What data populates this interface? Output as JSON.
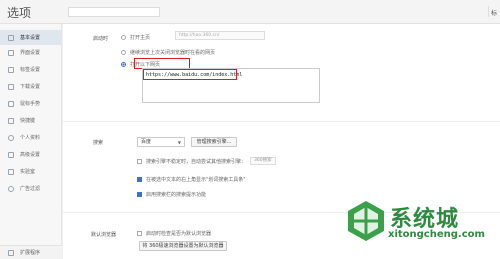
{
  "header": {
    "title": "选项",
    "right_label": "标"
  },
  "sidebar": {
    "items": [
      {
        "label": "基本设置",
        "icon": "gear-icon",
        "active": true
      },
      {
        "label": "界面设置",
        "icon": "window-icon"
      },
      {
        "label": "标签设置",
        "icon": "tab-icon"
      },
      {
        "label": "下载设置",
        "icon": "download-icon"
      },
      {
        "label": "鼠标手势",
        "icon": "mouse-icon"
      },
      {
        "label": "快捷键",
        "icon": "keyboard-icon"
      },
      {
        "label": "个人资料",
        "icon": "user-icon"
      },
      {
        "label": "高级设置",
        "icon": "advanced-icon"
      },
      {
        "label": "实验室",
        "icon": "lab-icon"
      },
      {
        "label": "广告过滤",
        "icon": "filter-icon"
      }
    ],
    "bottom": {
      "label": "扩展程序",
      "icon": "extension-icon"
    }
  },
  "startup": {
    "section_label": "启动时",
    "opt_homepage": "打开主页",
    "homepage_value": "http://hao.360.cn/",
    "opt_restore": "继续浏览上次关闭浏览器时在看的网页",
    "opt_open_pages": "打开以下网页",
    "urls": "https://www.baidu.com/index.html"
  },
  "search": {
    "section_label": "搜索",
    "engine": "百度",
    "manage_button": "管理搜索引擎...",
    "opt_suggest": "搜索引擎不稳定时，自动尝试其他搜索引擎：",
    "suggest_select": "360搜索",
    "opt_selected_text": "在被选中文本的右上角显示\"划词搜索工具条\"",
    "opt_enable_suggest": "启用搜索栏的搜索提示功能"
  },
  "default_browser": {
    "section_label": "默认浏览器",
    "opt_check": "启动时检查是否为默认浏览器",
    "set_button": "将 360极速浏览器设置为默认浏览器"
  },
  "watermark": {
    "title": "系统城",
    "url": "xitongcheng.com"
  }
}
